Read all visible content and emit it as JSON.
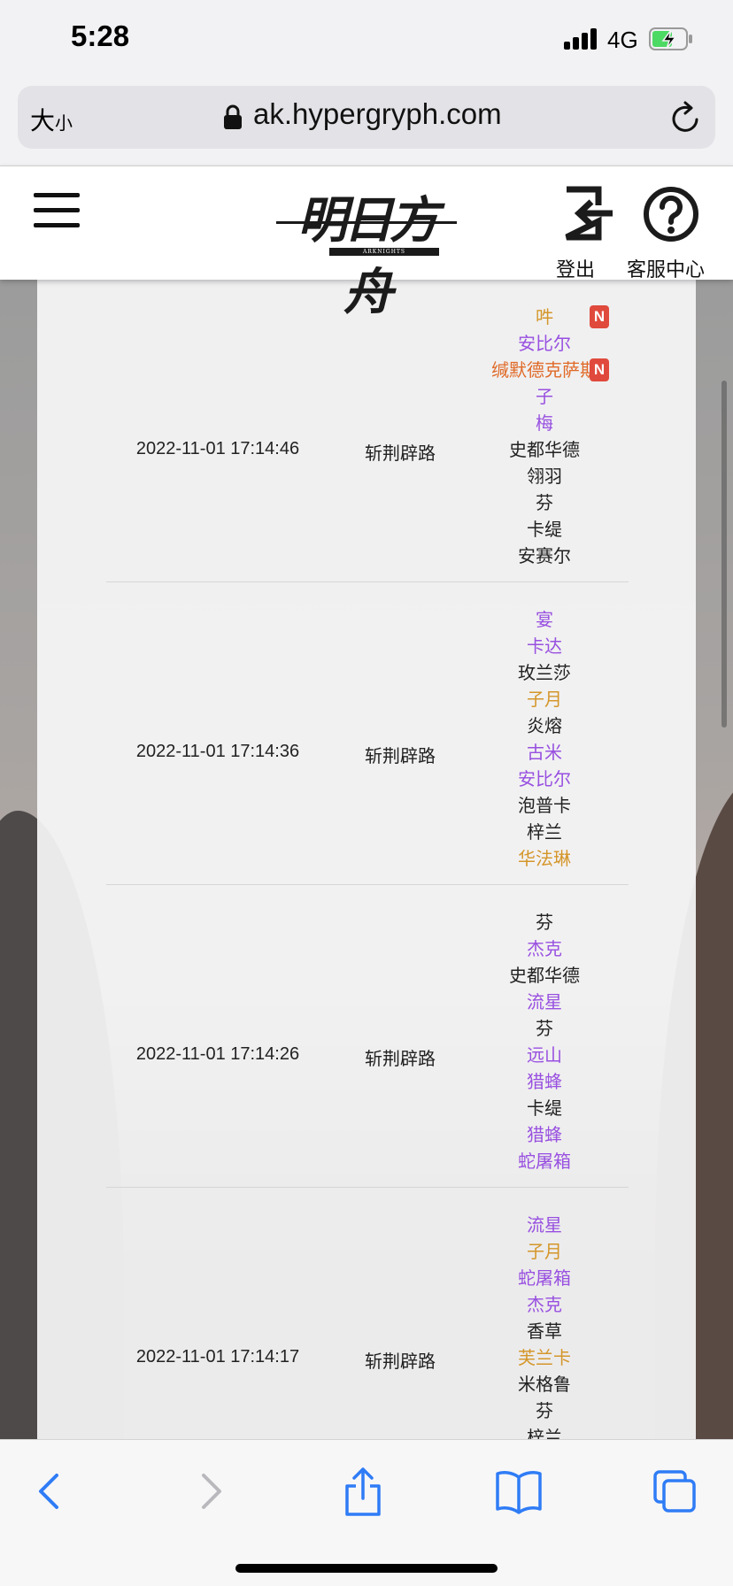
{
  "status_bar": {
    "time": "5:28",
    "network": "4G",
    "battery_state": "charging"
  },
  "browser": {
    "text_size_label_big": "大",
    "text_size_label_small": "小",
    "url": "ak.hypergryph.com"
  },
  "header": {
    "logo_text": "明日方舟",
    "logo_subtext": "ARKNIGHTS",
    "logout_label": "登出",
    "service_label": "客服中心"
  },
  "colors": {
    "rarity3": "#222222",
    "rarity4": "#9850e0",
    "rarity5": "#d4962a",
    "rarity6": "#e06a28",
    "new_badge": "#e04a3c"
  },
  "new_badge_label": "N",
  "records": [
    {
      "time": "2022-11-01 17:14:46",
      "pool": "斩荆辟路",
      "characters": [
        {
          "name": "吽",
          "rarity": 5,
          "is_new": true
        },
        {
          "name": "安比尔",
          "rarity": 4,
          "is_new": false
        },
        {
          "name": "缄默德克萨斯",
          "rarity": 6,
          "is_new": true
        },
        {
          "name": "子",
          "rarity": 4,
          "is_new": false
        },
        {
          "name": "梅",
          "rarity": 4,
          "is_new": false
        },
        {
          "name": "史都华德",
          "rarity": 3,
          "is_new": false
        },
        {
          "name": "翎羽",
          "rarity": 3,
          "is_new": false
        },
        {
          "name": "芬",
          "rarity": 3,
          "is_new": false
        },
        {
          "name": "卡缇",
          "rarity": 3,
          "is_new": false
        },
        {
          "name": "安赛尔",
          "rarity": 3,
          "is_new": false
        }
      ]
    },
    {
      "time": "2022-11-01 17:14:36",
      "pool": "斩荆辟路",
      "characters": [
        {
          "name": "宴",
          "rarity": 4,
          "is_new": false
        },
        {
          "name": "卡达",
          "rarity": 4,
          "is_new": false
        },
        {
          "name": "玫兰莎",
          "rarity": 3,
          "is_new": false
        },
        {
          "name": "子月",
          "rarity": 5,
          "is_new": false
        },
        {
          "name": "炎熔",
          "rarity": 3,
          "is_new": false
        },
        {
          "name": "古米",
          "rarity": 4,
          "is_new": false
        },
        {
          "name": "安比尔",
          "rarity": 4,
          "is_new": false
        },
        {
          "name": "泡普卡",
          "rarity": 3,
          "is_new": false
        },
        {
          "name": "梓兰",
          "rarity": 3,
          "is_new": false
        },
        {
          "name": "华法琳",
          "rarity": 5,
          "is_new": false
        }
      ]
    },
    {
      "time": "2022-11-01 17:14:26",
      "pool": "斩荆辟路",
      "characters": [
        {
          "name": "芬",
          "rarity": 3,
          "is_new": false
        },
        {
          "name": "杰克",
          "rarity": 4,
          "is_new": false
        },
        {
          "name": "史都华德",
          "rarity": 3,
          "is_new": false
        },
        {
          "name": "流星",
          "rarity": 4,
          "is_new": false
        },
        {
          "name": "芬",
          "rarity": 3,
          "is_new": false
        },
        {
          "name": "远山",
          "rarity": 4,
          "is_new": false
        },
        {
          "name": "猎蜂",
          "rarity": 4,
          "is_new": false
        },
        {
          "name": "卡缇",
          "rarity": 3,
          "is_new": false
        },
        {
          "name": "猎蜂",
          "rarity": 4,
          "is_new": false
        },
        {
          "name": "蛇屠箱",
          "rarity": 4,
          "is_new": false
        }
      ]
    },
    {
      "time": "2022-11-01 17:14:17",
      "pool": "斩荆辟路",
      "characters": [
        {
          "name": "流星",
          "rarity": 4,
          "is_new": false
        },
        {
          "name": "子月",
          "rarity": 5,
          "is_new": false
        },
        {
          "name": "蛇屠箱",
          "rarity": 4,
          "is_new": false
        },
        {
          "name": "杰克",
          "rarity": 4,
          "is_new": false
        },
        {
          "name": "香草",
          "rarity": 3,
          "is_new": false
        },
        {
          "name": "芙兰卡",
          "rarity": 5,
          "is_new": false
        },
        {
          "name": "米格鲁",
          "rarity": 3,
          "is_new": false
        },
        {
          "name": "芬",
          "rarity": 3,
          "is_new": false
        },
        {
          "name": "梓兰",
          "rarity": 3,
          "is_new": false
        }
      ]
    }
  ]
}
